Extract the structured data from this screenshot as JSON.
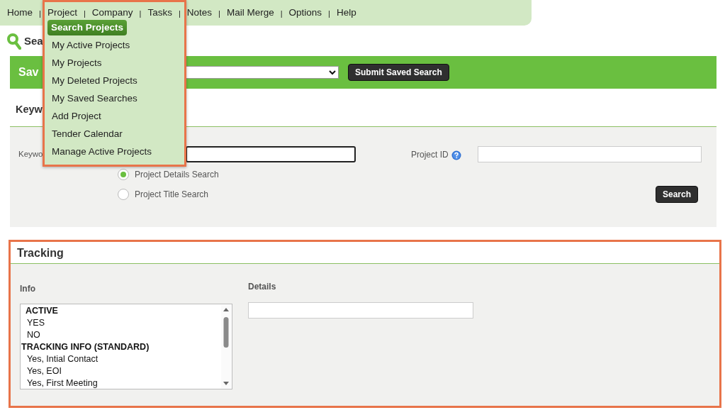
{
  "nav": {
    "items": [
      {
        "label": "Home",
        "separator": "|"
      },
      {
        "label": "Project",
        "separator": "|"
      },
      {
        "label": "Company",
        "separator": "|"
      },
      {
        "label": "Tasks",
        "separator": "|"
      },
      {
        "label": "Notes",
        "separator": "|"
      },
      {
        "label": "Mail Merge",
        "separator": "|"
      },
      {
        "label": "Options",
        "separator": "|"
      },
      {
        "label": "Help"
      }
    ]
  },
  "project_menu": [
    {
      "label": "Search Projects",
      "selected": true
    },
    {
      "label": "My Active Projects",
      "selected": false
    },
    {
      "label": "My Projects",
      "selected": false
    },
    {
      "label": "My Deleted Projects",
      "selected": false
    },
    {
      "label": "My Saved Searches",
      "selected": false
    },
    {
      "label": "Add Project",
      "selected": false
    },
    {
      "label": "Tender Calendar",
      "selected": false
    },
    {
      "label": "Manage Active Projects",
      "selected": false
    }
  ],
  "page_title": "Sea",
  "saved_search": {
    "label": "Sav",
    "button": "Submit Saved Search"
  },
  "keyword_section": {
    "title": "Keyw",
    "keyword_label": "Keywo",
    "project_id_label": "Project ID",
    "search_modes": [
      {
        "label": "Project Details Search",
        "selected": true
      },
      {
        "label": "Project Title Search",
        "selected": false
      }
    ],
    "search_button": "Search"
  },
  "tracking": {
    "title": "Tracking",
    "info_label": "Info",
    "details_label": "Details",
    "info_options": [
      {
        "kind": "group",
        "label": "ACTIVE",
        "indent": true
      },
      {
        "kind": "option",
        "label": "YES"
      },
      {
        "kind": "option",
        "label": "NO"
      },
      {
        "kind": "group",
        "label": "TRACKING INFO (STANDARD)",
        "indent": false
      },
      {
        "kind": "option",
        "label": "Yes, Intial Contact"
      },
      {
        "kind": "option",
        "label": "Yes, EOI"
      },
      {
        "kind": "option",
        "label": "Yes, First Meeting"
      }
    ]
  }
}
